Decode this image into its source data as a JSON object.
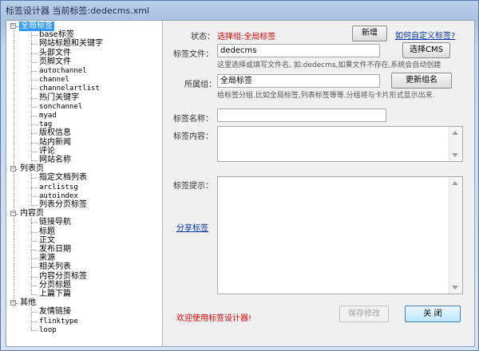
{
  "window": {
    "title": "标签设计器 当前标签:dedecms.xml"
  },
  "tree": {
    "groups": [
      {
        "label": "全局标签",
        "selected": true,
        "children": [
          "base标签",
          "网站标题和关键字",
          "头部文件",
          "页脚文件",
          "autochannel",
          "channel",
          "channelartlist",
          "热门关键字",
          "sonchannel",
          "myad",
          "tag",
          "版权信息",
          "站内新闻",
          "评论",
          "网站名称"
        ]
      },
      {
        "label": "列表页",
        "selected": false,
        "children": [
          "指定文档列表",
          "arclistsg",
          "autoindex",
          "列表分页标签"
        ]
      },
      {
        "label": "内容页",
        "selected": false,
        "children": [
          "链接导航",
          "标题",
          "正文",
          "发布日期",
          "来源",
          "相关列表",
          "内容分页标签",
          "分页标题",
          "上篇下篇"
        ]
      },
      {
        "label": "其他",
        "selected": false,
        "children": [
          "友情链接",
          "flinktype",
          "loop"
        ]
      }
    ]
  },
  "form": {
    "status_label": "状态：",
    "status_value": "选择组:全局标签",
    "new_button": "新增",
    "custom_tag_link": "如何自定义标签?",
    "file_label": "标签文件：",
    "file_value": "dedecms",
    "select_cms_button": "选择CMS",
    "file_hint": "这里选择或填写文件名, 如:dedecms,如果文件不存在,系统会自动创建",
    "group_label": "所属组：",
    "group_value": "全局标签",
    "update_group_button": "更新组名",
    "group_hint": "给标签分组.比如全局标签,列表标签等等.分组将与卡片形式显示出来.",
    "name_label": "标签名称：",
    "name_value": "",
    "content_label": "标签内容：",
    "tip_label": "标签提示：",
    "share_link": "分享标签",
    "welcome": "欢迎使用标签设计器!",
    "save_button": "保存修改",
    "close_button": "关 闭"
  }
}
